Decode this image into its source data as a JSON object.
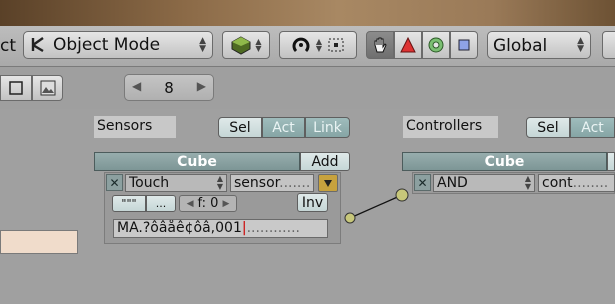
{
  "toolbar": {
    "partial_label": "ct",
    "mode_select": {
      "value": "Object Mode",
      "icon": "object-mode-icon"
    },
    "orientation_select": {
      "value": "Global"
    },
    "icons": [
      "shading-sphere-icon",
      "rotate-pivot-icon",
      "grid-snap-icon",
      "hand-grab-icon",
      "translate-triangle-icon",
      "rotate-circle-icon",
      "scale-square-icon",
      "toolbar-button-icon"
    ]
  },
  "header2": {
    "view_icons": [
      "window-icon",
      "image-icon"
    ],
    "state_field": {
      "value": "8"
    }
  },
  "sensors": {
    "label": "Sensors",
    "filter_buttons": [
      "Sel",
      "Act",
      "Link"
    ],
    "object": {
      "name": "Cube",
      "add_label": "Add"
    },
    "brick": {
      "type": "Touch",
      "name": "sensor",
      "pulse_true": "\"\"\"",
      "pulse_false": "...",
      "freq_label": "f: 0",
      "invert_label": "Inv",
      "material_value": "MA.?ôâåê¢ôâ,001"
    }
  },
  "controllers": {
    "label": "Controllers",
    "filter_buttons": [
      "Sel",
      "Act"
    ],
    "object": {
      "name": "Cube"
    },
    "brick": {
      "type": "AND",
      "name": "cont"
    }
  }
}
